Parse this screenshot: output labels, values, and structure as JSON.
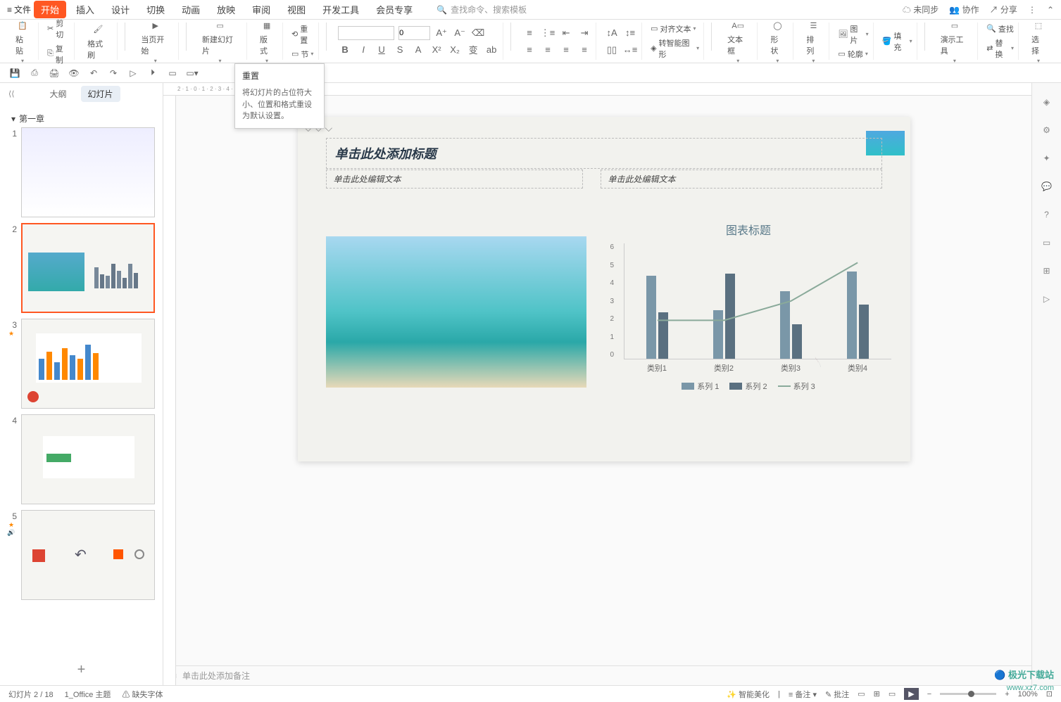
{
  "menu": {
    "file": "文件",
    "tabs": [
      "开始",
      "插入",
      "设计",
      "切换",
      "动画",
      "放映",
      "审阅",
      "视图",
      "开发工具",
      "会员专享"
    ],
    "active_tab": "开始",
    "search_placeholder": "查找命令、搜索模板",
    "sync": "未同步",
    "collab": "协作",
    "share": "分享"
  },
  "ribbon": {
    "paste": "粘贴",
    "cut": "剪切",
    "copy": "复制",
    "format_painter": "格式刷",
    "from_current": "当页开始",
    "new_slide": "新建幻灯片",
    "layout": "版式",
    "reset": "重置",
    "section": "节",
    "font_size": "0",
    "align_text": "对齐文本",
    "smart_shape": "转智能图形",
    "text_box": "文本框",
    "shape": "形状",
    "arrange": "排列",
    "picture": "图片",
    "fill": "填充",
    "outline": "轮廓",
    "demo_tools": "演示工具",
    "find": "查找",
    "replace": "替换",
    "select": "选择"
  },
  "tooltip": {
    "title": "重置",
    "desc": "将幻灯片的占位符大小、位置和格式重设为默认设置。"
  },
  "panel": {
    "outline_tab": "大纲",
    "slides_tab": "幻灯片",
    "chapter": "第一章"
  },
  "slide": {
    "title_placeholder": "单击此处添加标题",
    "text_placeholder_left": "单击此处编辑文本",
    "text_placeholder_right": "单击此处编辑文本"
  },
  "chart_data": {
    "type": "bar",
    "title": "图表标题",
    "categories": [
      "类别1",
      "类别2",
      "类别3",
      "类别4"
    ],
    "series": [
      {
        "name": "系列 1",
        "values": [
          4.3,
          2.5,
          3.5,
          4.5
        ]
      },
      {
        "name": "系列 2",
        "values": [
          2.4,
          4.4,
          1.8,
          2.8
        ]
      },
      {
        "name": "系列 3",
        "values": [
          2,
          2,
          3,
          5
        ],
        "type": "line"
      }
    ],
    "ylim": [
      0,
      6
    ],
    "yticks": [
      0,
      1,
      2,
      3,
      4,
      5,
      6
    ]
  },
  "notes": {
    "placeholder": "单击此处添加备注"
  },
  "status": {
    "slide_counter": "幻灯片 2 / 18",
    "theme": "1_Office 主题",
    "missing_font": "缺失字体",
    "smart_beautify": "智能美化",
    "notes_btn": "备注",
    "review_btn": "批注",
    "zoom": "100%"
  },
  "watermark": {
    "line1": "极光下载站",
    "line2": "www.xz7.com"
  }
}
